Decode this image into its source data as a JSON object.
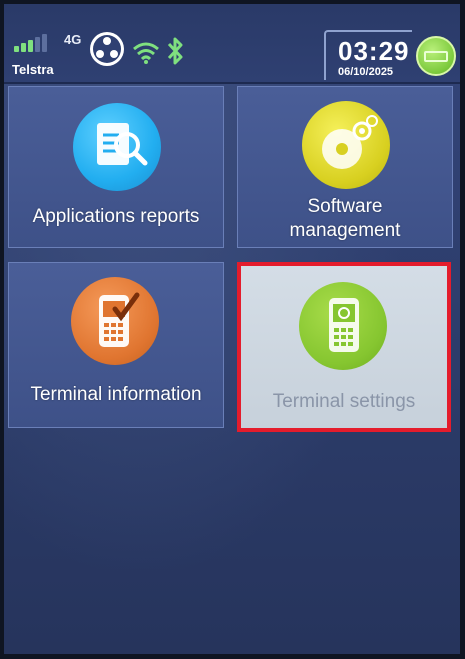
{
  "status": {
    "network_type": "4G",
    "carrier": "Telstra",
    "time": "03:29",
    "date": "06/10/2025"
  },
  "tiles": [
    {
      "id": "applications-reports",
      "label": "Applications reports",
      "icon": "document-search-icon",
      "color": "#22aef0"
    },
    {
      "id": "software-management",
      "label_line1": "Software",
      "label_line2": "management",
      "icon": "disc-gear-icon",
      "color": "#d8d020"
    },
    {
      "id": "terminal-information",
      "label": "Terminal information",
      "icon": "terminal-check-icon",
      "color": "#e07530"
    },
    {
      "id": "terminal-settings",
      "label": "Terminal settings",
      "icon": "terminal-gear-icon",
      "color": "#86c630",
      "selected": true
    }
  ],
  "colors": {
    "background": "#2c3c6a",
    "tile": "#4a5e98",
    "selection_border": "#e41c2c"
  }
}
